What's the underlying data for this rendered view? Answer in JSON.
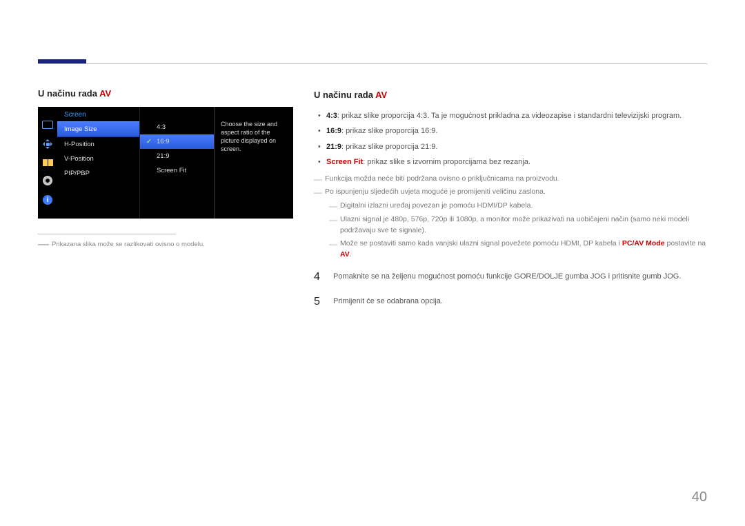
{
  "heading": {
    "prefix": "U načinu rada ",
    "mode": "AV"
  },
  "osd": {
    "title": "Screen",
    "menu": [
      "Image Size",
      "H-Position",
      "V-Position",
      "PIP/PBP"
    ],
    "opts": [
      "4:3",
      "16:9",
      "21:9",
      "Screen Fit"
    ],
    "info": "Choose the size and aspect ratio of the picture displayed on screen.",
    "info_icon": "i"
  },
  "footnote": "Prikazana slika može se razlikovati ovisno o modelu.",
  "bullets": {
    "b1_label": "4:3",
    "b1_text": ": prikaz slike proporcija 4:3. Ta je mogućnost prikladna za videozapise i standardni televizijski program.",
    "b2_label": "16:9",
    "b2_text": ": prikaz slike proporcija 16:9.",
    "b3_label": "21:9",
    "b3_text": ": prikaz slike proporcija 21:9.",
    "b4_label": "Screen Fit",
    "b4_text": ": prikaz slike s izvornim proporcijama bez rezanja."
  },
  "notes": {
    "n1": "Funkcija možda neće biti podržana ovisno o priključnicama na proizvodu.",
    "n2": "Po ispunjenju sljedećih uvjeta moguće je promijeniti veličinu zaslona.",
    "n3": "Digitalni izlazni uređaj povezan je pomoću HDMI/DP kabela.",
    "n4": "Ulazni signal je 480p, 576p, 720p ili 1080p, a monitor može prikazivati na uobičajeni način (samo neki modeli podržavaju sve te signale).",
    "n5_a": "Može se postaviti samo kada vanjski ulazni signal povežete pomoću HDMI, DP kabela i ",
    "n5_b": "PC/AV Mode",
    "n5_c": " postavite na ",
    "n5_d": "AV",
    "n5_e": "."
  },
  "steps": {
    "s4_num": "4",
    "s4": "Pomaknite se na željenu mogućnost pomoću funkcije GORE/DOLJE gumba JOG i pritisnite gumb JOG.",
    "s5_num": "5",
    "s5": "Primijenit će se odabrana opcija."
  },
  "page": "40"
}
